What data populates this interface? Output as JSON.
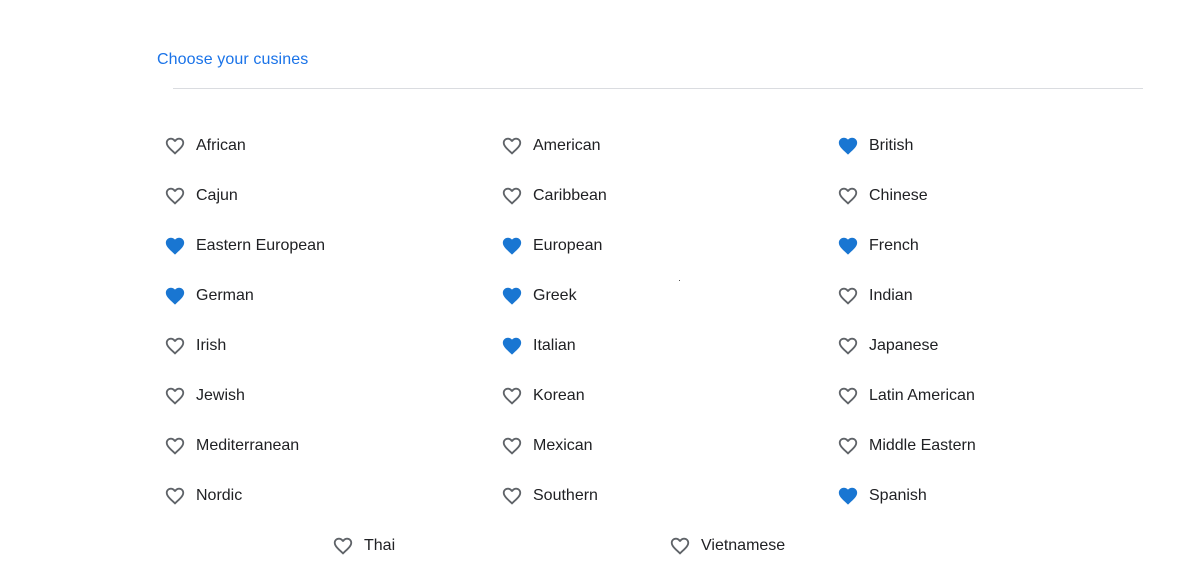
{
  "heading": "Choose your cusines",
  "colors": {
    "accent": "#1a73e8",
    "selected_heart": "#1976d2",
    "unselected_heart": "#5f6368",
    "text": "#202124"
  },
  "icons": {
    "selected": "heart-filled-icon",
    "unselected": "heart-outline-icon"
  },
  "cuisines": [
    {
      "label": "African",
      "selected": false
    },
    {
      "label": "American",
      "selected": false
    },
    {
      "label": "British",
      "selected": true
    },
    {
      "label": "Cajun",
      "selected": false
    },
    {
      "label": "Caribbean",
      "selected": false
    },
    {
      "label": "Chinese",
      "selected": false
    },
    {
      "label": "Eastern European",
      "selected": true
    },
    {
      "label": "European",
      "selected": true
    },
    {
      "label": "French",
      "selected": true
    },
    {
      "label": "German",
      "selected": true
    },
    {
      "label": "Greek",
      "selected": true
    },
    {
      "label": "Indian",
      "selected": false
    },
    {
      "label": "Irish",
      "selected": false
    },
    {
      "label": "Italian",
      "selected": true
    },
    {
      "label": "Japanese",
      "selected": false
    },
    {
      "label": "Jewish",
      "selected": false
    },
    {
      "label": "Korean",
      "selected": false
    },
    {
      "label": "Latin American",
      "selected": false
    },
    {
      "label": "Mediterranean",
      "selected": false
    },
    {
      "label": "Mexican",
      "selected": false
    },
    {
      "label": "Middle Eastern",
      "selected": false
    },
    {
      "label": "Nordic",
      "selected": false
    },
    {
      "label": "Southern",
      "selected": false
    },
    {
      "label": "Spanish",
      "selected": true
    },
    {
      "label": "Thai",
      "selected": false
    },
    {
      "label": "Vietnamese",
      "selected": false
    }
  ]
}
